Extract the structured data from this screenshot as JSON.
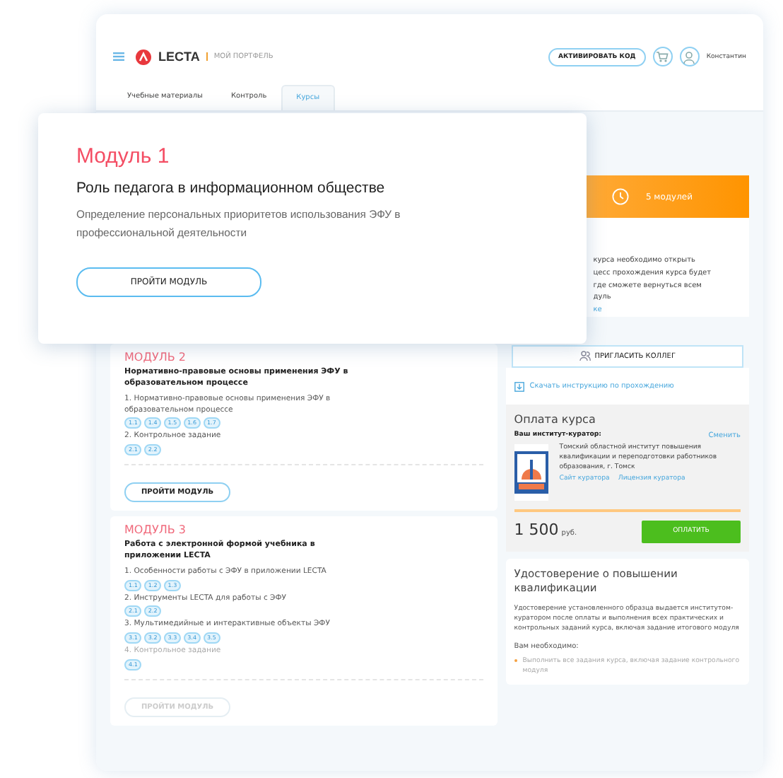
{
  "header": {
    "logo": "LECTA",
    "section": "МОЙ ПОРТФЕЛЬ",
    "activate_button": "АКТИВИРОВАТЬ КОД",
    "user": "Константин"
  },
  "tabs": [
    {
      "label": "Учебные материалы",
      "selected": false
    },
    {
      "label": "Контроль",
      "selected": false
    },
    {
      "label": "Курсы",
      "selected": true
    }
  ],
  "featured_module": {
    "heading": "Модуль 1",
    "title": "Роль педагога в информационном обществе",
    "description": "Определение персональных приоритетов использования ЭФУ в профессиональной деятельности",
    "button": "ПРОЙТИ МОДУЛЬ"
  },
  "modules": [
    {
      "heading": "МОДУЛЬ 2",
      "title": "Нормативно-правовые основы применения ЭФУ в образовательном процессе",
      "button": "ПРОЙТИ МОДУЛЬ",
      "button_disabled": false,
      "lessons": [
        {
          "title": "1. Нормативно-правовые основы применения ЭФУ в образовательном процессе",
          "disabled": false,
          "tags": [
            "1.1",
            "1.4",
            "1.5",
            "1.6",
            "1.7"
          ]
        },
        {
          "title": "2. Контрольное задание",
          "disabled": false,
          "tags": [
            "2.1",
            "2.2"
          ]
        }
      ]
    },
    {
      "heading": "МОДУЛЬ 3",
      "title": "Работа с электронной формой учебника в приложении LECTA",
      "button": "ПРОЙТИ МОДУЛЬ",
      "button_disabled": true,
      "lessons": [
        {
          "title": "1. Особенности работы с ЭФУ в приложении LECTA",
          "disabled": false,
          "tags": [
            "1.1",
            "1.2",
            "1.3"
          ]
        },
        {
          "title": "2. Инструменты LECTA для работы с ЭФУ",
          "disabled": false,
          "tags": [
            "2.1",
            "2.2"
          ]
        },
        {
          "title": "3. Мультимедийные и интерактивные объекты ЭФУ",
          "disabled": false,
          "tags": [
            "3.1",
            "3.2",
            "3.3",
            "3.4",
            "3.5"
          ]
        },
        {
          "title": "4. Контрольное задание",
          "disabled": true,
          "tags": [
            "4.1"
          ]
        }
      ]
    }
  ],
  "course_info": {
    "modules_count": "5 модулей",
    "note_lines": [
      "курса необходимо открыть",
      "цесс прохождения курса будет",
      "где сможете вернуться всем",
      "дуль"
    ],
    "note_link": "ке",
    "invite_button": "ПРИГЛАСИТЬ КОЛЛЕГ",
    "download_link": "Скачать инструкцию по прохождению"
  },
  "payment": {
    "title": "Оплата курса",
    "curator_label": "Ваш институт-куратор:",
    "change_link": "Сменить",
    "curator_name": "Томский областной институт повышения квалификации и переподготовки работников образования, г. Томск",
    "links": [
      "Сайт куратора",
      "Лицензия куратора"
    ],
    "price": "1 500",
    "currency": "руб.",
    "pay_button": "ОПЛАТИТЬ"
  },
  "certificate": {
    "title": "Удостоверение о повышении квалификации",
    "text": "Удостоверение установленного образца выдается институтом-куратором после оплаты и выполнения всех практических и контрольных заданий курса, включая задание итогового модуля",
    "needs_label": "Вам необходимо:",
    "needs": [
      "Выполнить все задания курса, включая задание контрольного модуля"
    ]
  }
}
